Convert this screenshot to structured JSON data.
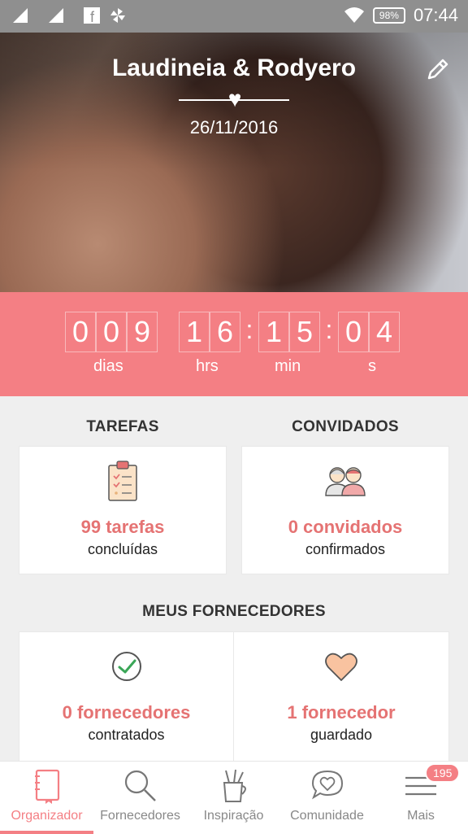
{
  "status": {
    "time": "07:44",
    "battery": "98%"
  },
  "hero": {
    "title": "Laudineia & Rodyero",
    "date": "26/11/2016"
  },
  "countdown": {
    "dias": [
      "0",
      "0",
      "9"
    ],
    "hrs": [
      "1",
      "6"
    ],
    "min": [
      "1",
      "5"
    ],
    "s": [
      "0",
      "4"
    ],
    "labels": {
      "dias": "dias",
      "hrs": "hrs",
      "min": "min",
      "s": "s"
    }
  },
  "tarefas": {
    "title": "TAREFAS",
    "value": "99 tarefas",
    "caption": "concluídas"
  },
  "convidados": {
    "title": "CONVIDADOS",
    "value": "0 convidados",
    "caption": "confirmados"
  },
  "fornecedores": {
    "title": "MEUS FORNECEDORES",
    "contratados": {
      "value": "0 fornecedores",
      "caption": "contratados"
    },
    "guardado": {
      "value": "1 fornecedor",
      "caption": "guardado"
    }
  },
  "tabs": [
    {
      "label": "Organizador"
    },
    {
      "label": "Fornecedores"
    },
    {
      "label": "Inspiração"
    },
    {
      "label": "Comunidade"
    },
    {
      "label": "Mais"
    }
  ],
  "notif_count": "195",
  "colors": {
    "accent": "#f47f84",
    "accent_text": "#e57373"
  }
}
